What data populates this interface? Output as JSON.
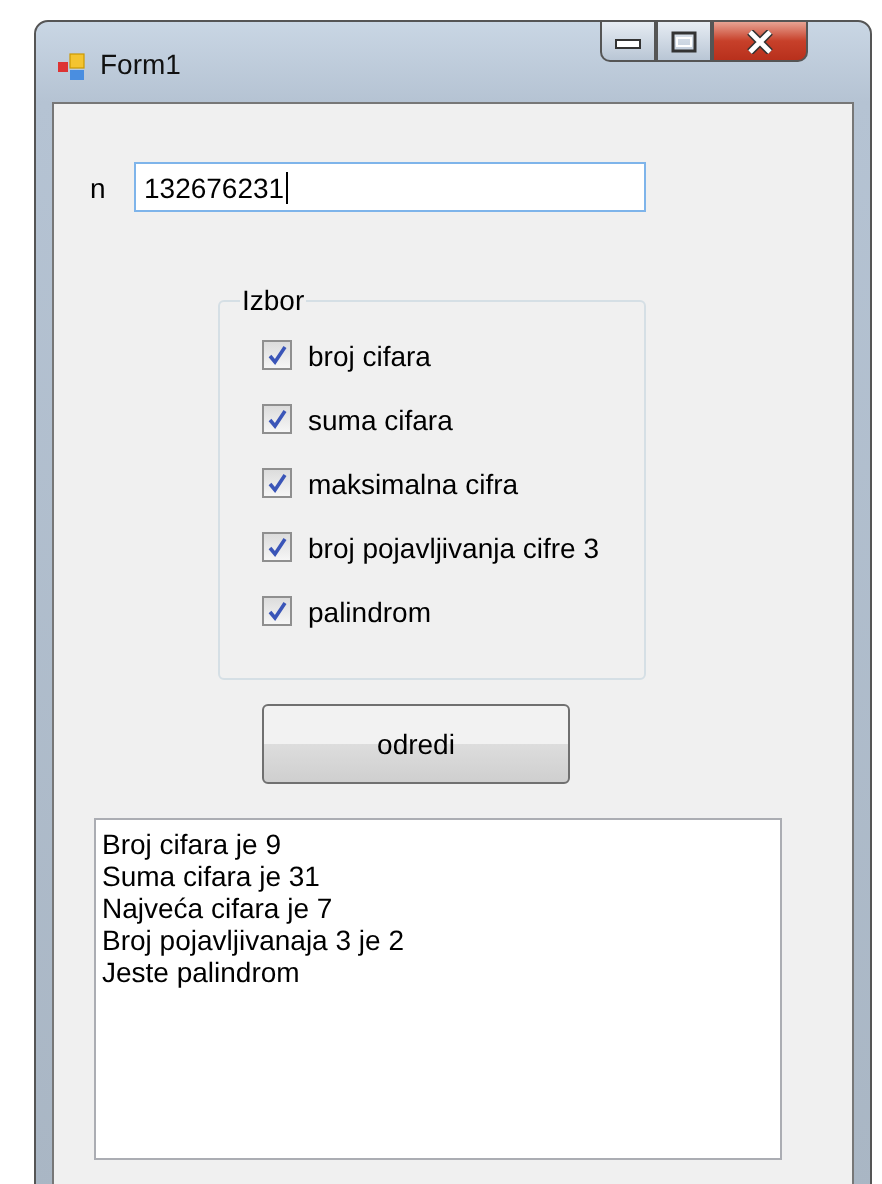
{
  "window": {
    "title": "Form1"
  },
  "n_field": {
    "label": "n",
    "value": "132676231"
  },
  "group": {
    "title": "Izbor",
    "options": [
      {
        "label": "broj cifara",
        "checked": true
      },
      {
        "label": "suma cifara",
        "checked": true
      },
      {
        "label": "maksimalna cifra",
        "checked": true
      },
      {
        "label": "broj pojavljivanja cifre 3",
        "checked": true
      },
      {
        "label": "palindrom",
        "checked": true
      }
    ]
  },
  "button": {
    "label": "odredi"
  },
  "results": [
    "Broj cifara je 9",
    "Suma cifara je 31",
    "Najveća cifara je 7",
    "Broj pojavljivanaja 3 je 2",
    "Jeste palindrom"
  ]
}
